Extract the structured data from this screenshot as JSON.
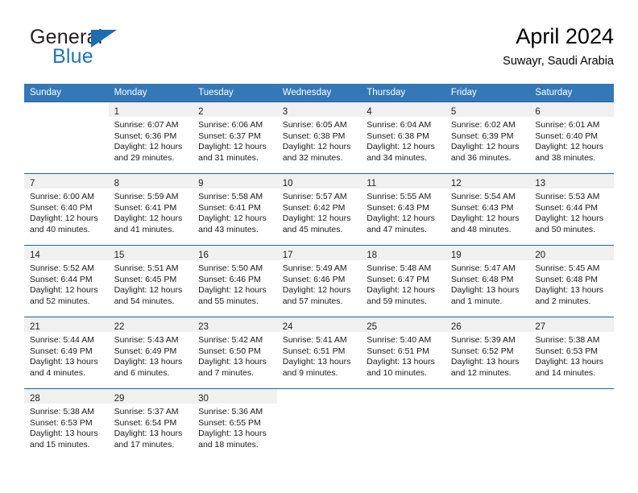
{
  "brand": {
    "name_part1": "General",
    "name_part2": "Blue"
  },
  "header": {
    "title": "April 2024",
    "subtitle": "Suwayr, Saudi Arabia"
  },
  "colors": {
    "header_blue": "#3478b8",
    "rule_blue": "#1b64a5",
    "datenum_band": "#f0f0f0",
    "brand_blue": "#1f76bc"
  },
  "weekdays": [
    "Sunday",
    "Monday",
    "Tuesday",
    "Wednesday",
    "Thursday",
    "Friday",
    "Saturday"
  ],
  "weeks": [
    [
      {
        "day": "",
        "lines": []
      },
      {
        "day": "1",
        "lines": [
          "Sunrise: 6:07 AM",
          "Sunset: 6:36 PM",
          "Daylight: 12 hours",
          "and 29 minutes."
        ]
      },
      {
        "day": "2",
        "lines": [
          "Sunrise: 6:06 AM",
          "Sunset: 6:37 PM",
          "Daylight: 12 hours",
          "and 31 minutes."
        ]
      },
      {
        "day": "3",
        "lines": [
          "Sunrise: 6:05 AM",
          "Sunset: 6:38 PM",
          "Daylight: 12 hours",
          "and 32 minutes."
        ]
      },
      {
        "day": "4",
        "lines": [
          "Sunrise: 6:04 AM",
          "Sunset: 6:38 PM",
          "Daylight: 12 hours",
          "and 34 minutes."
        ]
      },
      {
        "day": "5",
        "lines": [
          "Sunrise: 6:02 AM",
          "Sunset: 6:39 PM",
          "Daylight: 12 hours",
          "and 36 minutes."
        ]
      },
      {
        "day": "6",
        "lines": [
          "Sunrise: 6:01 AM",
          "Sunset: 6:40 PM",
          "Daylight: 12 hours",
          "and 38 minutes."
        ]
      }
    ],
    [
      {
        "day": "7",
        "lines": [
          "Sunrise: 6:00 AM",
          "Sunset: 6:40 PM",
          "Daylight: 12 hours",
          "and 40 minutes."
        ]
      },
      {
        "day": "8",
        "lines": [
          "Sunrise: 5:59 AM",
          "Sunset: 6:41 PM",
          "Daylight: 12 hours",
          "and 41 minutes."
        ]
      },
      {
        "day": "9",
        "lines": [
          "Sunrise: 5:58 AM",
          "Sunset: 6:41 PM",
          "Daylight: 12 hours",
          "and 43 minutes."
        ]
      },
      {
        "day": "10",
        "lines": [
          "Sunrise: 5:57 AM",
          "Sunset: 6:42 PM",
          "Daylight: 12 hours",
          "and 45 minutes."
        ]
      },
      {
        "day": "11",
        "lines": [
          "Sunrise: 5:55 AM",
          "Sunset: 6:43 PM",
          "Daylight: 12 hours",
          "and 47 minutes."
        ]
      },
      {
        "day": "12",
        "lines": [
          "Sunrise: 5:54 AM",
          "Sunset: 6:43 PM",
          "Daylight: 12 hours",
          "and 48 minutes."
        ]
      },
      {
        "day": "13",
        "lines": [
          "Sunrise: 5:53 AM",
          "Sunset: 6:44 PM",
          "Daylight: 12 hours",
          "and 50 minutes."
        ]
      }
    ],
    [
      {
        "day": "14",
        "lines": [
          "Sunrise: 5:52 AM",
          "Sunset: 6:44 PM",
          "Daylight: 12 hours",
          "and 52 minutes."
        ]
      },
      {
        "day": "15",
        "lines": [
          "Sunrise: 5:51 AM",
          "Sunset: 6:45 PM",
          "Daylight: 12 hours",
          "and 54 minutes."
        ]
      },
      {
        "day": "16",
        "lines": [
          "Sunrise: 5:50 AM",
          "Sunset: 6:46 PM",
          "Daylight: 12 hours",
          "and 55 minutes."
        ]
      },
      {
        "day": "17",
        "lines": [
          "Sunrise: 5:49 AM",
          "Sunset: 6:46 PM",
          "Daylight: 12 hours",
          "and 57 minutes."
        ]
      },
      {
        "day": "18",
        "lines": [
          "Sunrise: 5:48 AM",
          "Sunset: 6:47 PM",
          "Daylight: 12 hours",
          "and 59 minutes."
        ]
      },
      {
        "day": "19",
        "lines": [
          "Sunrise: 5:47 AM",
          "Sunset: 6:48 PM",
          "Daylight: 13 hours",
          "and 1 minute."
        ]
      },
      {
        "day": "20",
        "lines": [
          "Sunrise: 5:45 AM",
          "Sunset: 6:48 PM",
          "Daylight: 13 hours",
          "and 2 minutes."
        ]
      }
    ],
    [
      {
        "day": "21",
        "lines": [
          "Sunrise: 5:44 AM",
          "Sunset: 6:49 PM",
          "Daylight: 13 hours",
          "and 4 minutes."
        ]
      },
      {
        "day": "22",
        "lines": [
          "Sunrise: 5:43 AM",
          "Sunset: 6:49 PM",
          "Daylight: 13 hours",
          "and 6 minutes."
        ]
      },
      {
        "day": "23",
        "lines": [
          "Sunrise: 5:42 AM",
          "Sunset: 6:50 PM",
          "Daylight: 13 hours",
          "and 7 minutes."
        ]
      },
      {
        "day": "24",
        "lines": [
          "Sunrise: 5:41 AM",
          "Sunset: 6:51 PM",
          "Daylight: 13 hours",
          "and 9 minutes."
        ]
      },
      {
        "day": "25",
        "lines": [
          "Sunrise: 5:40 AM",
          "Sunset: 6:51 PM",
          "Daylight: 13 hours",
          "and 10 minutes."
        ]
      },
      {
        "day": "26",
        "lines": [
          "Sunrise: 5:39 AM",
          "Sunset: 6:52 PM",
          "Daylight: 13 hours",
          "and 12 minutes."
        ]
      },
      {
        "day": "27",
        "lines": [
          "Sunrise: 5:38 AM",
          "Sunset: 6:53 PM",
          "Daylight: 13 hours",
          "and 14 minutes."
        ]
      }
    ],
    [
      {
        "day": "28",
        "lines": [
          "Sunrise: 5:38 AM",
          "Sunset: 6:53 PM",
          "Daylight: 13 hours",
          "and 15 minutes."
        ]
      },
      {
        "day": "29",
        "lines": [
          "Sunrise: 5:37 AM",
          "Sunset: 6:54 PM",
          "Daylight: 13 hours",
          "and 17 minutes."
        ]
      },
      {
        "day": "30",
        "lines": [
          "Sunrise: 5:36 AM",
          "Sunset: 6:55 PM",
          "Daylight: 13 hours",
          "and 18 minutes."
        ]
      },
      {
        "day": "",
        "lines": []
      },
      {
        "day": "",
        "lines": []
      },
      {
        "day": "",
        "lines": []
      },
      {
        "day": "",
        "lines": []
      }
    ]
  ]
}
